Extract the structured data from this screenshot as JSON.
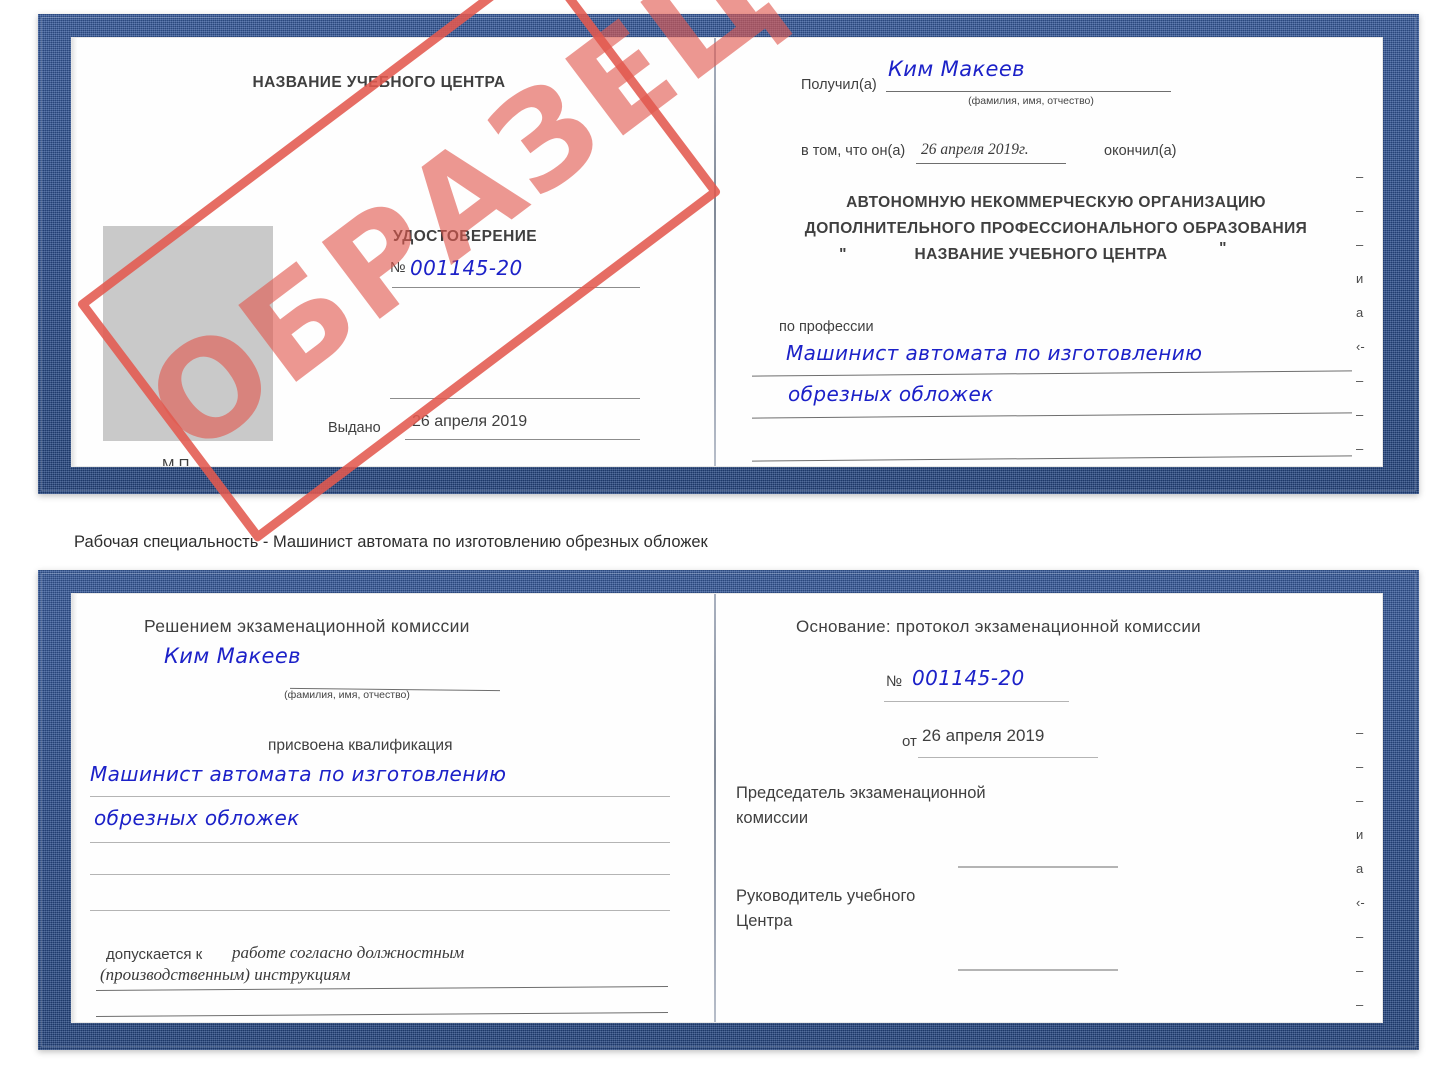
{
  "caption": "Рабочая специальность - Машинист автомата по изготовлению обрезных обложек",
  "stamp": {
    "text": "ОБРАЗЕЦ",
    "color": "#e2594f"
  },
  "colors": {
    "cover_blue": "#2c5190",
    "handwriting_blue": "#1c21c8",
    "photo_gray": "#c9c9c9",
    "rule_gray": "#8c8c8c"
  },
  "doc1": {
    "left_page": {
      "center_name": "НАЗВАНИЕ УЧЕБНОГО ЦЕНТРА",
      "title": "УДОСТОВЕРЕНИЕ",
      "number_label": "№",
      "number_value": "001145-20",
      "issued_label": "Выдано",
      "issued_value": "26 апреля 2019",
      "seal_label": "М.П.",
      "photo_alt": "photo-placeholder"
    },
    "right_page": {
      "received_label": "Получил(а)",
      "received_value": "Ким Макеев",
      "fio_hint": "(фамилия, имя, отчество)",
      "in_that_label": "в том, что он(а)",
      "in_that_value": "26 апреля 2019г.",
      "finished_label": "окончил(а)",
      "org_line1": "АВТОНОМНУЮ НЕКОММЕРЧЕСКУЮ ОРГАНИЗАЦИЮ",
      "org_line2": "ДОПОЛНИТЕЛЬНОГО ПРОФЕССИОНАЛЬНОГО ОБРАЗОВАНИЯ",
      "org_quote_open": "\"",
      "org_name": "НАЗВАНИЕ УЧЕБНОГО ЦЕНТРА",
      "org_quote_close": "\"",
      "profession_label": "по профессии",
      "profession_line1": "Машинист автомата по изготовлению",
      "profession_line2": "обрезных обложек",
      "edge_fragments": [
        "–",
        "–",
        "–",
        "и",
        "а",
        "‹-",
        "–",
        "–",
        "–",
        "–"
      ]
    }
  },
  "doc2": {
    "left_page": {
      "heading": "Решением экзаменационной комиссии",
      "name_value": "Ким Макеев",
      "fio_hint": "(фамилия, имя, отчество)",
      "qualification_label": "присвоена квалификация",
      "qualification_line1": "Машинист автомата по изготовлению",
      "qualification_line2": "обрезных обложек",
      "admitted_label": "допускается к",
      "admitted_line1": "работе согласно должностным",
      "admitted_line2": "(производственным) инструкциям"
    },
    "right_page": {
      "basis_label": "Основание: протокол экзаменационной комиссии",
      "number_label": "№",
      "number_value": "001145-20",
      "from_label": "от",
      "from_value": "26 апреля 2019",
      "chairman_line1": "Председатель экзаменационной",
      "chairman_line2": "комиссии",
      "head_line1": "Руководитель учебного",
      "head_line2": "Центра",
      "edge_fragments": [
        "–",
        "–",
        "–",
        "и",
        "а",
        "‹-",
        "–",
        "–",
        "–",
        "–"
      ]
    }
  }
}
